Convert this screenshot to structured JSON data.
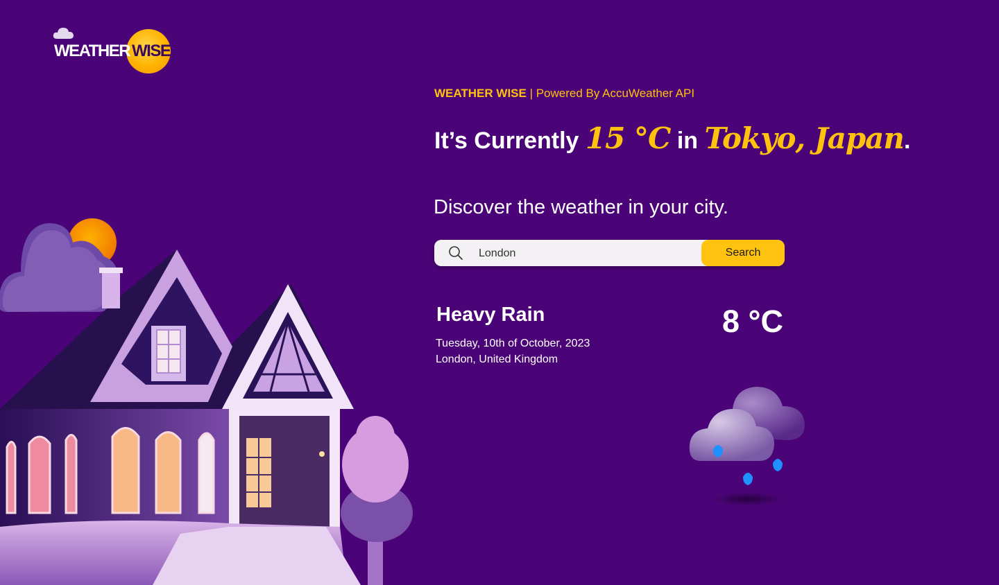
{
  "logo": {
    "word_weather": "WEATHER",
    "word_wise": "WISE"
  },
  "header": {
    "brand": "WEATHER WISE",
    "powered_by": " | Powered By AccuWeather API"
  },
  "current": {
    "prefix": "It’s Currently ",
    "temp": "15 °C",
    "middle": " in ",
    "city": "Tokyo, Japan",
    "suffix": "."
  },
  "discover": "Discover the weather in your city.",
  "search": {
    "value": "London",
    "button": "Search",
    "icon": "search-icon"
  },
  "result": {
    "condition": "Heavy Rain",
    "date": "Tuesday, 10th of October, 2023",
    "location": "London, United Kingdom",
    "temperature": "8 °C",
    "icon": "heavy-rain-icon"
  },
  "colors": {
    "background": "#4b0477",
    "accent": "#ffc20e",
    "text": "#ffffff",
    "search_bg": "#f4f1f5",
    "raindrop": "#1e90ff"
  }
}
